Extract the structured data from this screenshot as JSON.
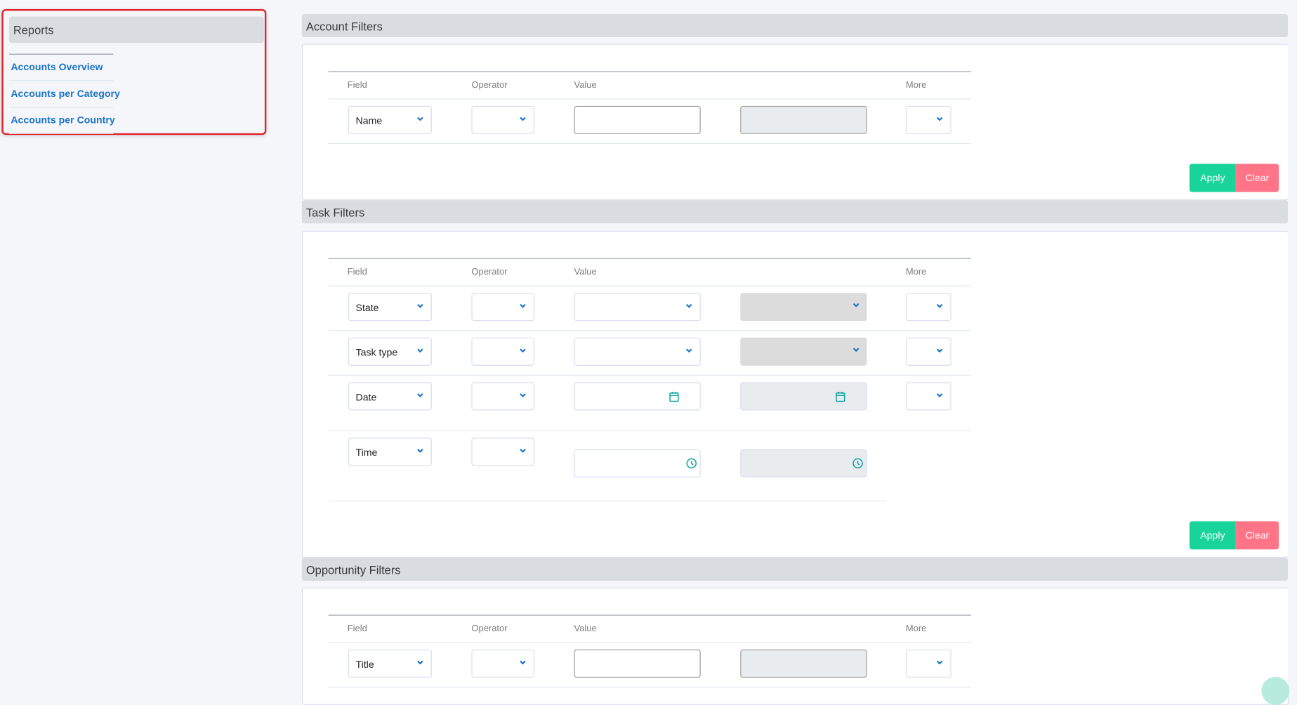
{
  "sidebar": {
    "title": "Reports",
    "links": [
      {
        "label": "Accounts Overview"
      },
      {
        "label": "Accounts per Category"
      },
      {
        "label": "Accounts per Country"
      }
    ]
  },
  "columns": {
    "field": "Field",
    "operator": "Operator",
    "value": "Value",
    "more": "More"
  },
  "sections": {
    "account": {
      "title": "Account Filters",
      "rows": [
        {
          "field": "Name",
          "operator": "",
          "value": "",
          "value2": "",
          "more": ""
        }
      ],
      "apply_label": "Apply",
      "clear_label": "Clear"
    },
    "task": {
      "title": "Task Filters",
      "rows": [
        {
          "field": "State",
          "operator": "",
          "value": "",
          "value2": "",
          "more": ""
        },
        {
          "field": "Task type",
          "operator": "",
          "value": "",
          "value2": "",
          "more": ""
        },
        {
          "field": "Date",
          "operator": "",
          "value": "",
          "value2": "",
          "more": ""
        },
        {
          "field": "Time",
          "operator": "",
          "value": "",
          "value2": ""
        }
      ],
      "apply_label": "Apply",
      "clear_label": "Clear"
    },
    "opportunity": {
      "title": "Opportunity Filters",
      "rows": [
        {
          "field": "Title",
          "operator": "",
          "value": "",
          "value2": "",
          "more": ""
        }
      ]
    }
  },
  "colors": {
    "apply": "#19d49a",
    "clear": "#ff7486",
    "link": "#1a73c9",
    "highlight_border": "#e0242b",
    "icon_teal": "#13a3a3"
  }
}
